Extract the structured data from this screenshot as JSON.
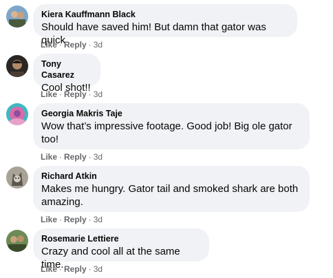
{
  "comments": [
    {
      "author": "Kiera Kauffmann Black",
      "text": "Should have saved him! But damn that gator was quick",
      "like": "Like",
      "reply": "Reply",
      "separator": "·",
      "time": "3d",
      "avatar_colors": [
        "#7fa6c9",
        "#d9b48f",
        "#4a5b3c"
      ]
    },
    {
      "author": "Tony Casarez",
      "text": "Cool shot!!",
      "like": "Like",
      "reply": "Reply",
      "separator": "·",
      "time": "3d",
      "avatar_colors": [
        "#2a2623",
        "#b18a6a",
        "#4b3c31"
      ]
    },
    {
      "author": "Georgia Makris Taje",
      "text": "Wow that’s impressive footage. Good job! Big ole gator too!",
      "like": "Like",
      "reply": "Reply",
      "separator": "·",
      "time": "3d",
      "avatar_colors": [
        "#d96aa8",
        "#3fb7c2",
        "#8d4fa0"
      ]
    },
    {
      "author": "Richard Atkin",
      "text": "Makes me hungry. Gator tail and smoked shark are both amazing.",
      "like": "Like",
      "reply": "Reply",
      "separator": "·",
      "time": "3d",
      "avatar_colors": [
        "#a9a397",
        "#5a564e",
        "#d6d0c4"
      ]
    },
    {
      "author": "Rosemarie Lettiere",
      "text": "Crazy and cool all at the same time.",
      "like": "Like",
      "reply": "Reply",
      "separator": "·",
      "time": "3d",
      "avatar_colors": [
        "#6d8b54",
        "#c9a27c",
        "#3b4a2b"
      ]
    }
  ]
}
